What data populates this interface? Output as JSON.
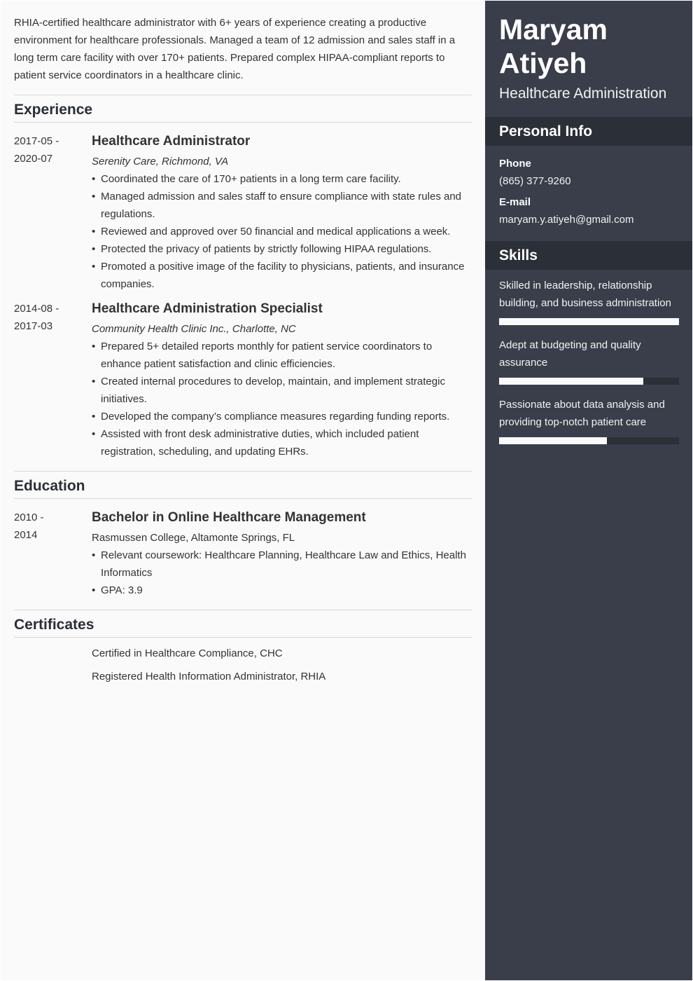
{
  "header": {
    "first_name": "Maryam",
    "last_name": "Atiyeh",
    "role": "Healthcare Administration"
  },
  "summary": "RHIA-certified healthcare administrator with 6+ years of experience creating a productive environment for healthcare professionals. Managed a team of 12 admission and sales staff in a long term care facility with over 170+ patients. Prepared complex HIPAA-compliant reports to patient service coordinators in a healthcare clinic.",
  "experience": {
    "title": "Experience",
    "entries": [
      {
        "date_start": "2017-05 -",
        "date_end": "2020-07",
        "title": "Healthcare Administrator",
        "org": "Serenity Care, Richmond, VA",
        "bullets": [
          "Coordinated the care of 170+ patients in a long term care facility.",
          "Managed admission and sales staff to ensure compliance with state rules and regulations.",
          "Reviewed and approved over 50 financial and medical applications a week.",
          "Protected the privacy of patients by strictly following HIPAA regulations.",
          "Promoted a positive image of the facility to physicians, patients, and insurance companies."
        ]
      },
      {
        "date_start": "2014-08 -",
        "date_end": "2017-03",
        "title": "Healthcare Administration Specialist",
        "org": "Community Health Clinic Inc., Charlotte, NC",
        "bullets": [
          "Prepared 5+ detailed reports monthly for patient service coordinators to enhance patient satisfaction and clinic efficiencies.",
          "Created internal procedures to develop, maintain, and implement strategic initiatives.",
          "Developed the company’s compliance measures regarding funding reports.",
          "Assisted with front desk administrative duties, which included patient registration, scheduling, and updating EHRs."
        ]
      }
    ]
  },
  "education": {
    "title": "Education",
    "entries": [
      {
        "date_start": "2010 -",
        "date_end": "2014",
        "title": "Bachelor in Online Healthcare Management",
        "org": "Rasmussen College, Altamonte Springs, FL",
        "bullets": [
          "Relevant coursework: Healthcare Planning, Healthcare Law and Ethics, Health Informatics",
          "GPA: 3.9"
        ]
      }
    ]
  },
  "certificates": {
    "title": "Certificates",
    "items": [
      "Certified in Healthcare Compliance, CHC",
      "Registered Health Information Administrator, RHIA"
    ]
  },
  "personal_info": {
    "title": "Personal Info",
    "phone_label": "Phone",
    "phone": "(865) 377-9260",
    "email_label": "E-mail",
    "email": "maryam.y.atiyeh@gmail.com"
  },
  "skills": {
    "title": "Skills",
    "items": [
      {
        "text": "Skilled in leadership, relationship building, and business administration",
        "level": 1.0
      },
      {
        "text": "Adept at budgeting and quality assurance",
        "level": 0.8
      },
      {
        "text": "Passionate about data analysis and providing top-notch patient care",
        "level": 0.6
      }
    ]
  },
  "colors": {
    "sidebar_bg": "#393e4a",
    "sidebar_header_bg": "#2b2f37",
    "main_bg": "#fafafa",
    "text": "#333333"
  }
}
